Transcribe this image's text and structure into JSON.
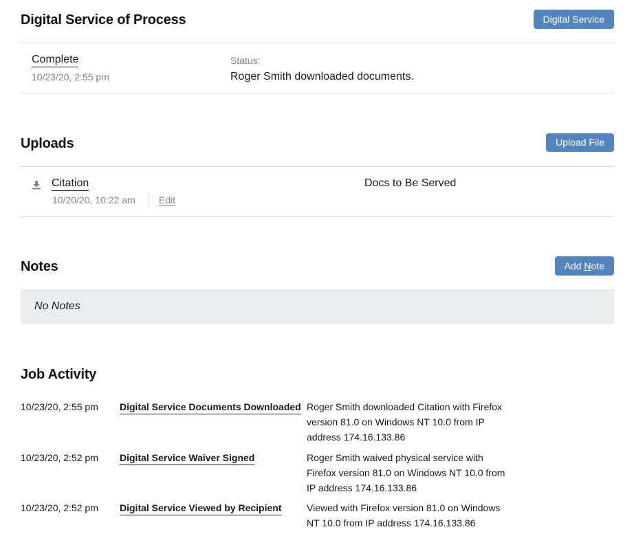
{
  "digital_service": {
    "title": "Digital Service of Process",
    "button_label": "Digital Service",
    "state": "Complete",
    "state_date": "10/23/20, 2:55 pm",
    "status_label": "Status:",
    "status_value": "Roger Smith downloaded documents."
  },
  "uploads": {
    "title": "Uploads",
    "button_label": "Upload File",
    "files": [
      {
        "icon": "download-icon",
        "name": "Citation",
        "date": "10/20/20, 10:22 am",
        "edit_label": "Edit",
        "type": "Docs to Be Served"
      }
    ]
  },
  "notes": {
    "title": "Notes",
    "button_prefix": "Add ",
    "button_underlined": "N",
    "button_suffix": "ote",
    "empty_text": "No Notes"
  },
  "job_activity": {
    "title": "Job Activity",
    "items": [
      {
        "date": "10/23/20, 2:55 pm",
        "title": "Digital Service Documents Downloaded",
        "description": "Roger Smith downloaded Citation with Firefox version 81.0 on Windows NT 10.0 from IP address 174.16.133.86"
      },
      {
        "date": "10/23/20, 2:52 pm",
        "title": "Digital Service Waiver Signed",
        "description": "Roger Smith waived physical service with Firefox version 81.0 on Windows NT 10.0 from IP address 174.16.133.86"
      },
      {
        "date": "10/23/20, 2:52 pm",
        "title": "Digital Service Viewed by Recipient",
        "description": "Viewed with Firefox version 81.0 on Windows NT 10.0 from IP address 174.16.133.86"
      }
    ]
  },
  "colors": {
    "button_bg": "#5384bf",
    "muted_text": "#7a8594",
    "empty_bg": "#ebecee",
    "divider": "#dcdcdc"
  }
}
